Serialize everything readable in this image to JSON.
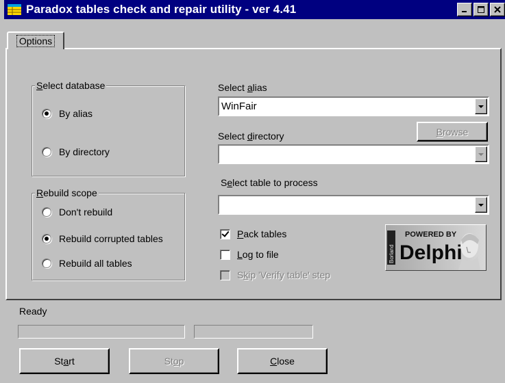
{
  "window": {
    "title": "Paradox tables check and repair utility - ver 4.41"
  },
  "tabs": [
    {
      "label": "Options",
      "active": true
    }
  ],
  "select_database": {
    "title_prefix": "S",
    "title_rest": "elect database",
    "options": [
      {
        "label": "By alias",
        "checked": true
      },
      {
        "label": "By directory",
        "checked": false
      }
    ]
  },
  "rebuild_scope": {
    "title_prefix": "R",
    "title_rest": "ebuild scope",
    "options": [
      {
        "label": "Don't rebuild",
        "checked": false
      },
      {
        "label": "Rebuild corrupted tables",
        "checked": true
      },
      {
        "label": "Rebuild all tables",
        "checked": false
      }
    ]
  },
  "alias": {
    "label_pre": "Select ",
    "label_ul": "a",
    "label_post": "lias",
    "value": "WinFair"
  },
  "directory": {
    "label_pre": "Select ",
    "label_ul": "d",
    "label_post": "irectory",
    "value": "",
    "browse_pre": "",
    "browse_ul": "B",
    "browse_post": "rowse"
  },
  "table": {
    "label_pre": "S",
    "label_ul": "e",
    "label_post": "lect table to process",
    "value": ""
  },
  "options": {
    "pack": {
      "pre": "",
      "ul": "P",
      "post": "ack tables",
      "checked": true
    },
    "log": {
      "pre": "",
      "ul": "L",
      "post": "og to file",
      "checked": false
    },
    "skip": {
      "pre": "S",
      "ul": "k",
      "post": "ip 'Verify table' step",
      "checked": false
    }
  },
  "logo": {
    "top_text": "POWERED BY",
    "main_text": "Delphi",
    "side_text": "Borland"
  },
  "status": "Ready",
  "buttons": {
    "start": {
      "pre": "St",
      "ul": "a",
      "post": "rt"
    },
    "stop": {
      "pre": "St",
      "ul": "o",
      "post": "p"
    },
    "close": {
      "pre": "",
      "ul": "C",
      "post": "lose"
    }
  },
  "colors": {
    "titlebar": "#000080",
    "face": "#c0c0c0",
    "disabled_text": "#808080"
  }
}
